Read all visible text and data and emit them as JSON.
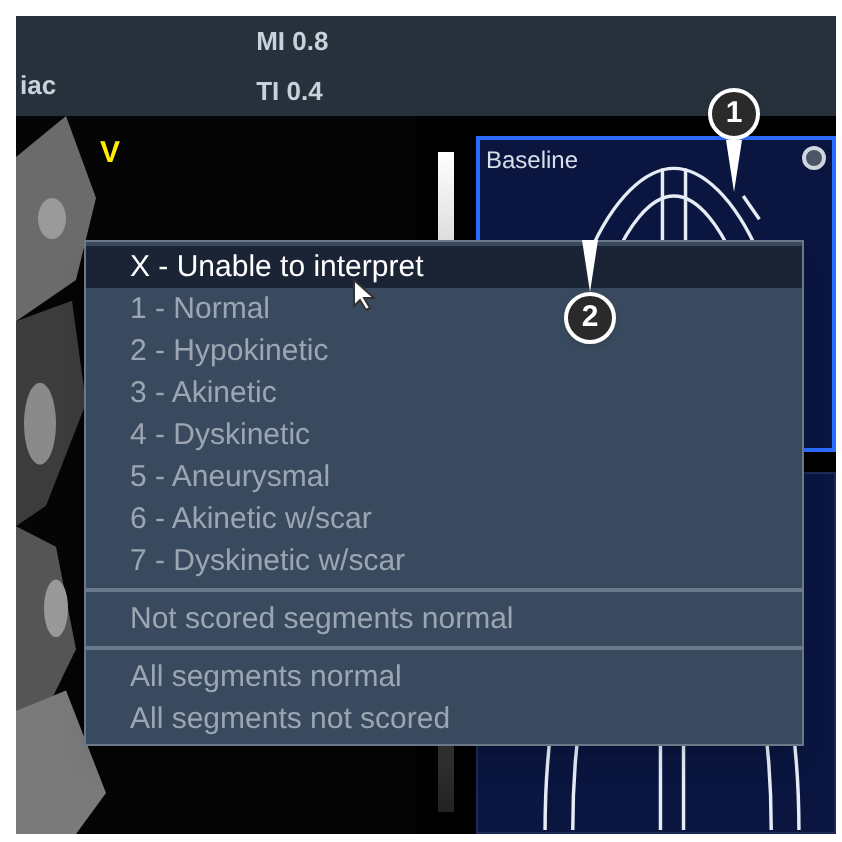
{
  "header": {
    "left_label": "iac",
    "readouts": [
      "MI 0.8",
      "TI 0.4"
    ]
  },
  "image": {
    "marker": "V"
  },
  "panels": [
    {
      "title": "Baseline",
      "selected": true
    },
    {
      "selected": false
    }
  ],
  "menu": {
    "sections": [
      [
        {
          "label": "X - Unable to interpret",
          "selected": true
        },
        {
          "label": "1 - Normal",
          "selected": false
        },
        {
          "label": "2 - Hypokinetic",
          "selected": false
        },
        {
          "label": "3 - Akinetic",
          "selected": false
        },
        {
          "label": "4 - Dyskinetic",
          "selected": false
        },
        {
          "label": "5 - Aneurysmal",
          "selected": false
        },
        {
          "label": "6 - Akinetic w/scar",
          "selected": false
        },
        {
          "label": "7 - Dyskinetic w/scar",
          "selected": false
        }
      ],
      [
        {
          "label": "Not scored segments normal",
          "selected": false
        }
      ],
      [
        {
          "label": "All segments normal",
          "selected": false
        },
        {
          "label": "All segments not scored",
          "selected": false
        }
      ]
    ]
  },
  "callouts": [
    "1",
    "2"
  ]
}
